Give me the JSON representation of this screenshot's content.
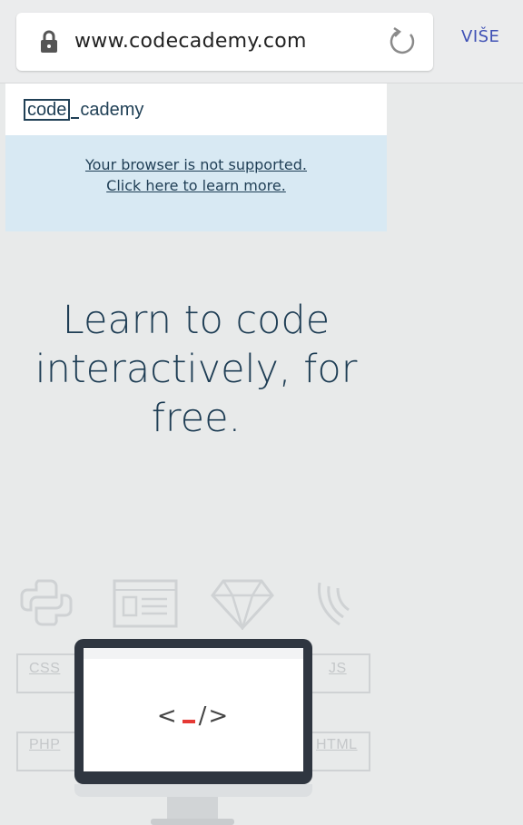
{
  "browser": {
    "url": "www.codecademy.com",
    "more_label": "VIŠE"
  },
  "site": {
    "logo_code": "code",
    "logo_rest": "cademy",
    "notice": "Your browser is not supported. Click here to learn more.",
    "hero_lines": [
      "Learn to code",
      "interactively, for",
      "free."
    ]
  },
  "illustration": {
    "tags": [
      "CSS",
      "PHP",
      "JS",
      "HTML"
    ],
    "code_open": "<",
    "code_close": "/>"
  },
  "colors": {
    "brand_navy": "#1f3e55",
    "link_blue": "#3f51b5",
    "notice_bg": "#d8e9f3",
    "caret_red": "#e53935"
  },
  "icons": [
    "lock-icon",
    "reload-icon",
    "python-icon",
    "browser-window-icon",
    "ruby-gem-icon",
    "wifi-arc-icon",
    "monitor-icon"
  ]
}
